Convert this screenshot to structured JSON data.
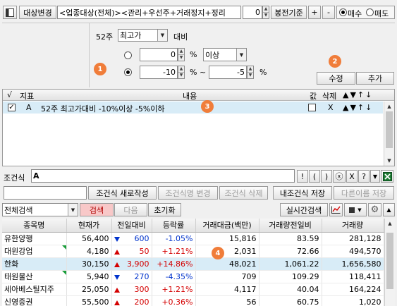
{
  "toolbar": {
    "target_change": "대상변경",
    "condition_text": "<업종대상(전체)><관리+우선주+거래정지+정리",
    "count": "0",
    "basis": "봉전기준",
    "plus": "+",
    "minus": "-",
    "buy": "매수",
    "sell": "매도"
  },
  "editor": {
    "label_52w": "52주",
    "indicator": "최고가",
    "compare": "대비",
    "row1": {
      "value": "0",
      "pct": "%",
      "relation": "이상"
    },
    "row2": {
      "value": "-10",
      "pct": "% ~",
      "value2": "-5",
      "pct2": "%"
    },
    "modify": "수정",
    "add": "추가"
  },
  "badges": {
    "b1": "1",
    "b2": "2",
    "b3": "3",
    "b4": "4"
  },
  "condition_list": {
    "headers": {
      "check": "√",
      "indicator": "지표",
      "content": "내용",
      "value": "값",
      "delete": "삭제",
      "arrows": "▲▼↑↓"
    },
    "rows": [
      {
        "checked": "✓",
        "letter": "A",
        "content": "52주 최고가대비 -10%이상 -5%이하",
        "delete": "X",
        "arrows": "▲▼↑↓"
      }
    ]
  },
  "formula": {
    "label": "조건식",
    "value": "A",
    "ops": [
      "!",
      "(",
      ")",
      "ⓧ",
      "X",
      "?"
    ]
  },
  "actions": {
    "new": "조건식 새로작성",
    "rename": "조건식명 변경",
    "delete": "조건식 삭제",
    "save": "내조건식 저장",
    "save_as": "다른이름 저장"
  },
  "search": {
    "scope": "전체검색",
    "search": "검색",
    "next": "다음",
    "reset": "초기화",
    "realtime": "실시간검색"
  },
  "results": {
    "headers": [
      "종목명",
      "현재가",
      "전일대비",
      "등락률",
      "거래대금(백만)",
      "거래량전일비",
      "거래량"
    ],
    "rows": [
      {
        "name": "유한양행",
        "price": "56,400",
        "dir": "down",
        "change": "600",
        "rate": "-1.05%",
        "amount": "15,816",
        "vol_ratio": "83.59",
        "volume": "281,128",
        "flag": false,
        "hl": false
      },
      {
        "name": "대원강업",
        "price": "4,180",
        "dir": "up",
        "change": "50",
        "rate": "+1.21%",
        "amount": "2,031",
        "vol_ratio": "72.66",
        "volume": "494,570",
        "flag": true,
        "hl": false
      },
      {
        "name": "한화",
        "price": "30,150",
        "dir": "up",
        "change": "3,900",
        "rate": "+14.86%",
        "amount": "48,021",
        "vol_ratio": "1,061.22",
        "volume": "1,656,580",
        "flag": false,
        "hl": true
      },
      {
        "name": "태원물산",
        "price": "5,940",
        "dir": "down",
        "change": "270",
        "rate": "-4.35%",
        "amount": "709",
        "vol_ratio": "109.29",
        "volume": "118,411",
        "flag": true,
        "hl": false
      },
      {
        "name": "세아베스틸지주",
        "price": "25,050",
        "dir": "up",
        "change": "300",
        "rate": "+1.21%",
        "amount": "4,117",
        "vol_ratio": "40.04",
        "volume": "164,224",
        "flag": false,
        "hl": false
      },
      {
        "name": "신영증권",
        "price": "55,500",
        "dir": "up",
        "change": "200",
        "rate": "+0.36%",
        "amount": "56",
        "vol_ratio": "60.75",
        "volume": "1,020",
        "flag": false,
        "hl": false
      }
    ]
  },
  "colors": {
    "up": "#d40000",
    "down": "#0033cc",
    "badge": "#f07d3a",
    "highlight": "#d8ecf7",
    "search_btn": "#f8c8c8"
  }
}
